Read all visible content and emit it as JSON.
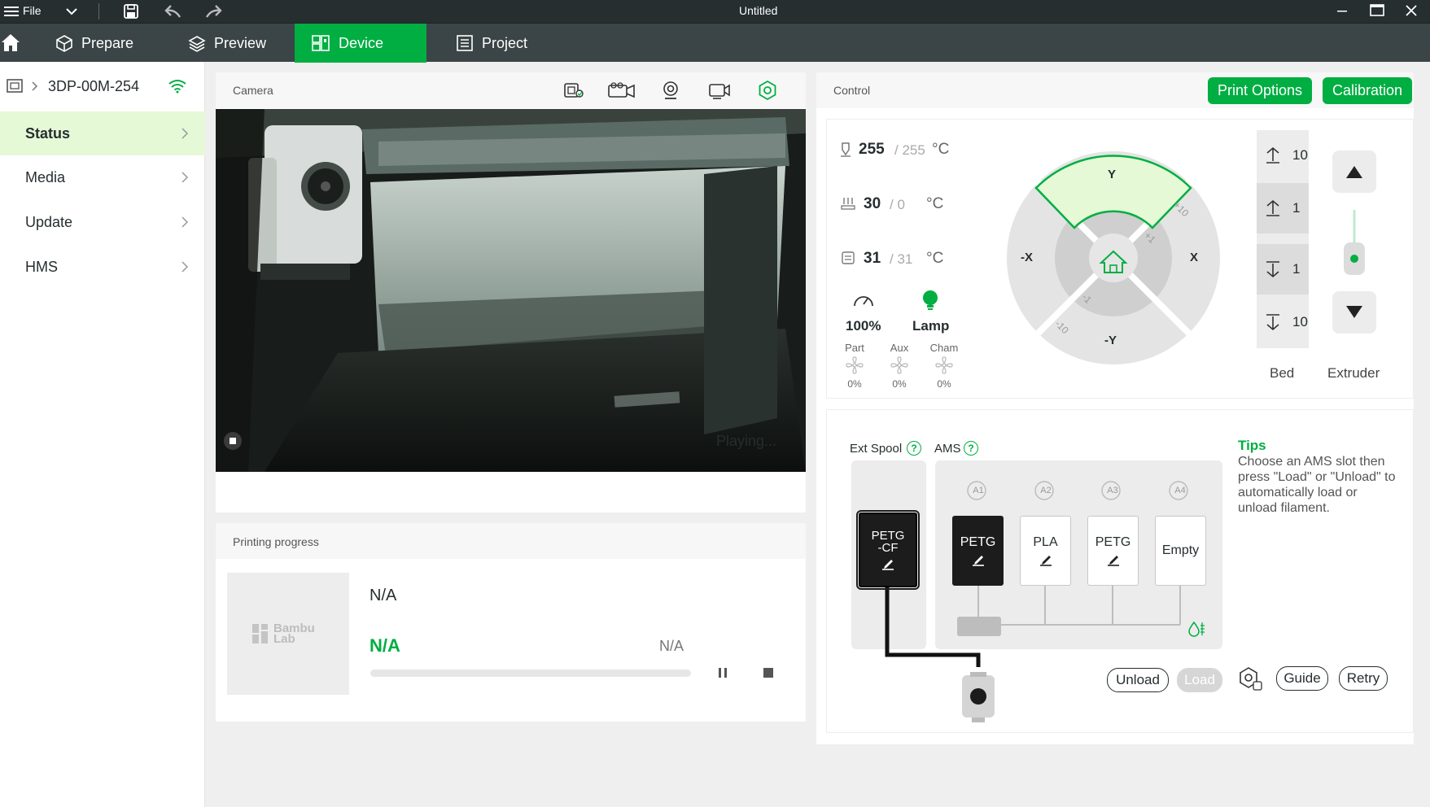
{
  "window": {
    "title": "Untitled",
    "file_menu": "File"
  },
  "tabs": [
    {
      "label": "Prepare"
    },
    {
      "label": "Preview"
    },
    {
      "label": "Device"
    },
    {
      "label": "Project"
    }
  ],
  "device": {
    "name": "3DP-00M-254"
  },
  "sidebar": {
    "items": [
      {
        "label": "Status"
      },
      {
        "label": "Media"
      },
      {
        "label": "Update"
      },
      {
        "label": "HMS"
      }
    ]
  },
  "camera": {
    "title": "Camera",
    "status": "Playing..."
  },
  "progress": {
    "title": "Printing progress",
    "logo_text": "Bambu Lab",
    "task_name": "N/A",
    "percent_text": "N/A",
    "time_text": "N/A",
    "fraction": 0
  },
  "control": {
    "title": "Control",
    "print_options": "Print Options",
    "calibration": "Calibration",
    "nozzle": {
      "current": "255",
      "target": "/ 255",
      "unit": "°C"
    },
    "bed": {
      "current": "30",
      "target": "/ 0",
      "unit": "°C"
    },
    "chamber": {
      "current": "31",
      "target": "/ 31",
      "unit": "°C"
    },
    "speed": "100%",
    "lamp": "Lamp",
    "fans": [
      {
        "label": "Part",
        "value": "0%"
      },
      {
        "label": "Aux",
        "value": "0%"
      },
      {
        "label": "Cham",
        "value": "0%"
      }
    ],
    "jog": {
      "y_plus": "Y",
      "y_minus": "-Y",
      "x_plus": "X",
      "x_minus": "-X",
      "step_10": "+10",
      "step_1": "+1",
      "step_m1": "-1",
      "step_m10": "-10"
    },
    "z_steps": [
      "10",
      "1",
      "1",
      "10"
    ],
    "bed_label": "Bed",
    "extruder_label": "Extruder"
  },
  "ams": {
    "ext_spool_label": "Ext Spool",
    "ams_label": "AMS",
    "help_mark": "?",
    "ext_slot": {
      "line1": "PETG",
      "line2": "-CF"
    },
    "slot_labels": [
      "A1",
      "A2",
      "A3",
      "A4"
    ],
    "slots": [
      {
        "material": "PETG"
      },
      {
        "material": "PLA"
      },
      {
        "material": "PETG"
      },
      {
        "material": "Empty"
      }
    ],
    "tips_title": "Tips",
    "tips_lines": [
      "Choose an AMS slot then",
      "press \"Load\" or \"Unload\" to",
      "automatically load or",
      "unload filament."
    ],
    "unload": "Unload",
    "load": "Load",
    "guide": "Guide",
    "retry": "Retry"
  },
  "colors": {
    "accent": "#00ae42",
    "titlebar": "#262e30",
    "tabbar": "#3b4446",
    "selected_row": "#e5f9d6"
  }
}
